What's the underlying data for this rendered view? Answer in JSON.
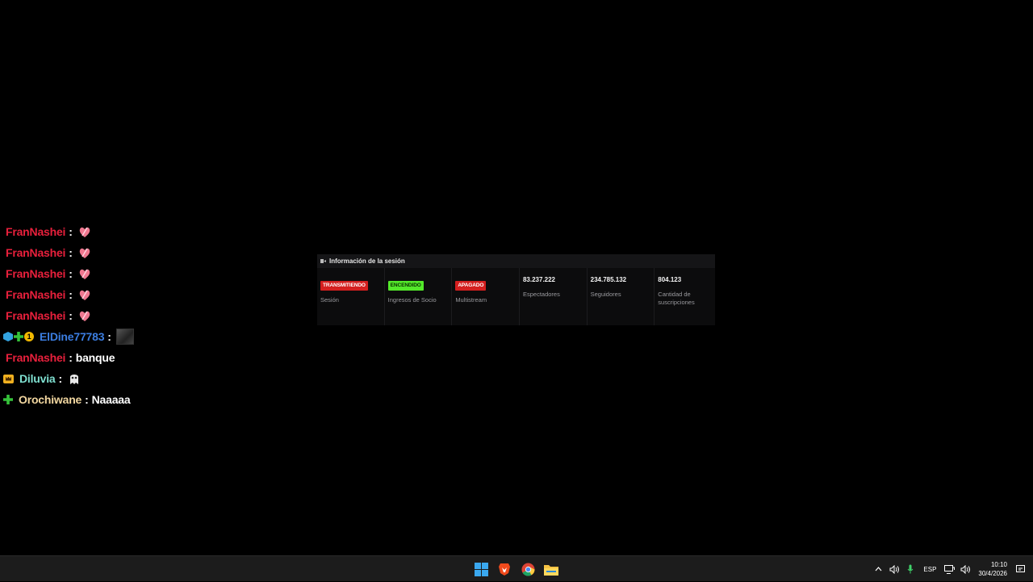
{
  "chat": {
    "messages": [
      {
        "user": "FranNashei",
        "color": "#e8203c",
        "badges": [],
        "text": "",
        "emote": "heart-emote"
      },
      {
        "user": "FranNashei",
        "color": "#e8203c",
        "badges": [],
        "text": "",
        "emote": "heart-emote"
      },
      {
        "user": "FranNashei",
        "color": "#e8203c",
        "badges": [],
        "text": "",
        "emote": "heart-emote"
      },
      {
        "user": "FranNashei",
        "color": "#e8203c",
        "badges": [],
        "text": "",
        "emote": "heart-emote"
      },
      {
        "user": "FranNashei",
        "color": "#e8203c",
        "badges": [],
        "text": "",
        "emote": "heart-emote"
      },
      {
        "user": "ElDine77783",
        "color": "#3b7de0",
        "badges": [
          "cube-badge",
          "plus-badge",
          "one-badge"
        ],
        "text": "",
        "emote": "image-emote"
      },
      {
        "user": "FranNashei",
        "color": "#e8203c",
        "badges": [],
        "text": "banque",
        "emote": ""
      },
      {
        "user": "Diluvia",
        "color": "#7fe0d0",
        "badges": [
          "crown-badge"
        ],
        "text": "",
        "emote": "ghost-emote"
      },
      {
        "user": "Orochiwane",
        "color": "#f2d7a0",
        "badges": [
          "plus-badge"
        ],
        "text": "Naaaaa",
        "emote": ""
      }
    ],
    "separator": ":"
  },
  "panel": {
    "title": "Información de la sesión",
    "cells": [
      {
        "pill": "TRANSMITIENDO",
        "pill_color": "#d41f1f",
        "label": "Sesión"
      },
      {
        "pill": "ENCENDIDO",
        "pill_color": "#53e82a",
        "label": "Ingresos de Socio"
      },
      {
        "pill": "APAGADO",
        "pill_color": "#d41f1f",
        "label": "Multistream"
      },
      {
        "value": "83.237.222",
        "label": "Espectadores"
      },
      {
        "value": "234.785.132",
        "label": "Seguidores"
      },
      {
        "value": "804.123",
        "label": "Cantidad de suscripciones"
      }
    ]
  },
  "taskbar": {
    "apps": [
      "windows-start-icon",
      "brave-browser-icon",
      "chrome-icon",
      "file-explorer-icon"
    ],
    "tray": {
      "language": "ESP",
      "time": "10:10",
      "date": "30/4/2026"
    }
  }
}
